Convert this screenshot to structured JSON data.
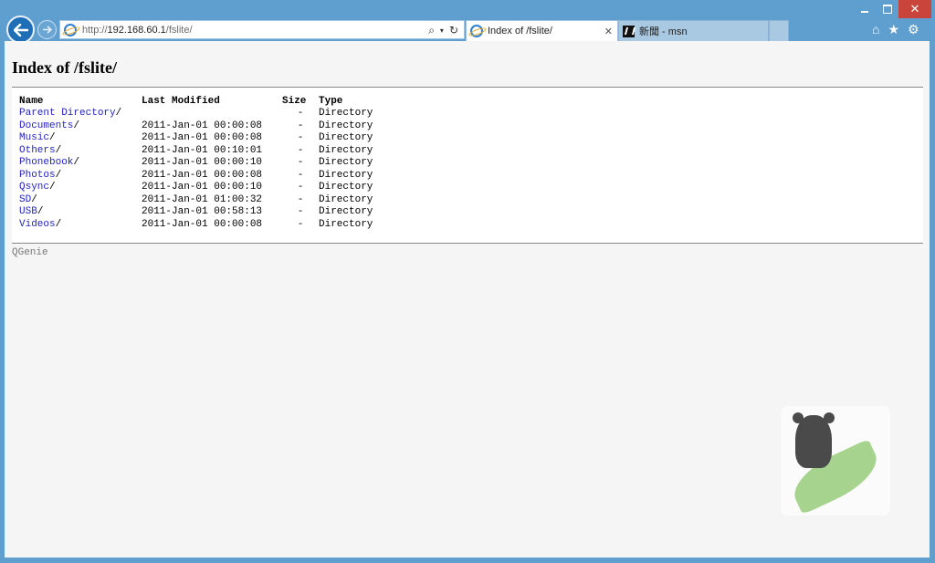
{
  "window": {
    "controls": [
      "minimize",
      "maximize",
      "close"
    ]
  },
  "addressbar": {
    "url_scheme": "http://",
    "url_host": "192.168.60.1",
    "url_path": "/fslite/"
  },
  "tabs": [
    {
      "label": "Index of /fslite/",
      "active": true,
      "icon": "ie-icon"
    },
    {
      "label": "新聞 - msn",
      "active": false,
      "icon": "msn-icon"
    }
  ],
  "toolbar_icons": [
    "home-icon",
    "favorites-icon",
    "settings-icon"
  ],
  "page": {
    "title": "Index of /fslite/",
    "columns": [
      "Name",
      "Last Modified",
      "Size",
      "Type"
    ],
    "rows": [
      {
        "name": "Parent Directory",
        "modified": "",
        "size": "-",
        "type": "Directory"
      },
      {
        "name": "Documents",
        "modified": "2011-Jan-01 00:00:08",
        "size": "-",
        "type": "Directory"
      },
      {
        "name": "Music",
        "modified": "2011-Jan-01 00:00:08",
        "size": "-",
        "type": "Directory"
      },
      {
        "name": "Others",
        "modified": "2011-Jan-01 00:10:01",
        "size": "-",
        "type": "Directory"
      },
      {
        "name": "Phonebook",
        "modified": "2011-Jan-01 00:00:10",
        "size": "-",
        "type": "Directory"
      },
      {
        "name": "Photos",
        "modified": "2011-Jan-01 00:00:08",
        "size": "-",
        "type": "Directory"
      },
      {
        "name": "Qsync",
        "modified": "2011-Jan-01 00:00:10",
        "size": "-",
        "type": "Directory"
      },
      {
        "name": "SD",
        "modified": "2011-Jan-01 01:00:32",
        "size": "-",
        "type": "Directory"
      },
      {
        "name": "USB",
        "modified": "2011-Jan-01 00:58:13",
        "size": "-",
        "type": "Directory"
      },
      {
        "name": "Videos",
        "modified": "2011-Jan-01 00:00:08",
        "size": "-",
        "type": "Directory"
      }
    ],
    "footer": "QGenie"
  },
  "colors": {
    "frame": "#5f9fd0",
    "link": "#2424c4",
    "close": "#c9443a"
  }
}
